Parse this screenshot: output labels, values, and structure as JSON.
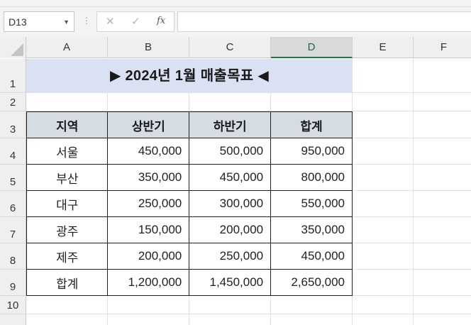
{
  "formula_bar": {
    "name_box": "D13",
    "cancel_icon": "✕",
    "confirm_icon": "✓",
    "function_icon": "fx",
    "formula": ""
  },
  "columns": [
    "A",
    "B",
    "C",
    "D",
    "E",
    "F"
  ],
  "selected_column": "D",
  "rows": [
    "1",
    "2",
    "3",
    "4",
    "5",
    "6",
    "7",
    "8",
    "9",
    "10"
  ],
  "title": "▶ 2024년 1월 매출목표 ◀",
  "table": {
    "headers": [
      "지역",
      "상반기",
      "하반기",
      "합계"
    ],
    "rows": [
      [
        "서울",
        "450,000",
        "500,000",
        "950,000"
      ],
      [
        "부산",
        "350,000",
        "450,000",
        "800,000"
      ],
      [
        "대구",
        "250,000",
        "300,000",
        "550,000"
      ],
      [
        "광주",
        "150,000",
        "200,000",
        "350,000"
      ],
      [
        "제주",
        "200,000",
        "250,000",
        "450,000"
      ],
      [
        "합계",
        "1,200,000",
        "1,450,000",
        "2,650,000"
      ]
    ]
  },
  "colors": {
    "title_fill": "#d9e1f2",
    "header_fill": "#d6dce4",
    "selection_accent": "#217346"
  }
}
